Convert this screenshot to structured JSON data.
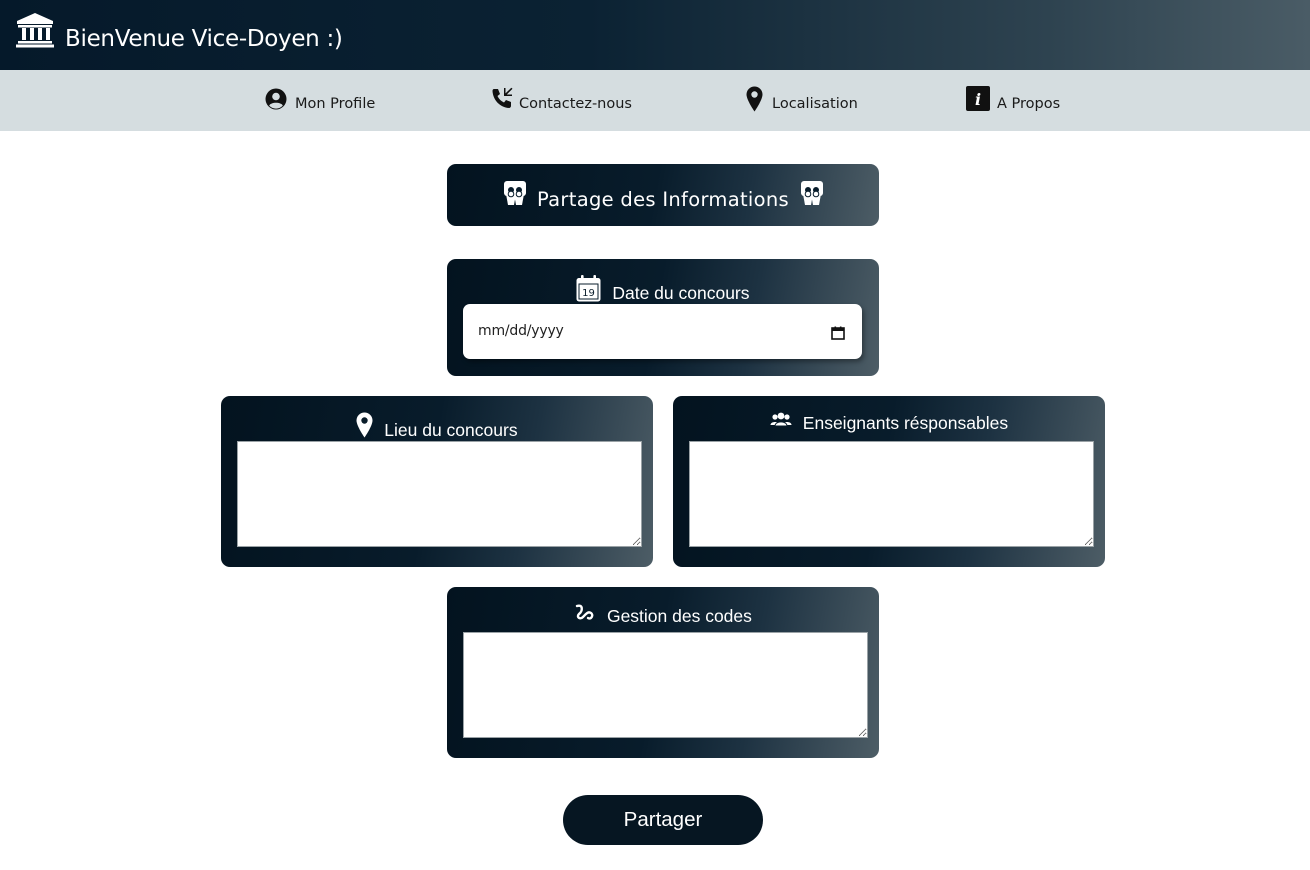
{
  "header": {
    "title": "BienVenue Vice-Doyen :)",
    "logo_icon": "university-building-icon"
  },
  "nav": {
    "items": [
      {
        "label": "Mon Profile",
        "icon": "user-circle-icon"
      },
      {
        "label": "Contactez-nous",
        "icon": "phone-icon"
      },
      {
        "label": "Localisation",
        "icon": "map-marker-icon"
      },
      {
        "label": "A Propos",
        "icon": "info-icon"
      }
    ]
  },
  "main": {
    "section_title": "Partage des Informations",
    "section_icon": "share-people-icon",
    "date": {
      "label": "Date du concours",
      "icon": "calendar-icon",
      "calendar_day": "19",
      "placeholder": "mm/dd/yyyy"
    },
    "lieu": {
      "label": "Lieu du concours",
      "icon": "map-marker-icon",
      "value": ""
    },
    "enseignants": {
      "label": "Enseignants résponsables",
      "icon": "users-icon",
      "value": ""
    },
    "codes": {
      "label": "Gestion des codes",
      "icon": "squiggle-icon",
      "value": ""
    },
    "submit_label": "Partager"
  },
  "colors": {
    "header_dark": "#05192a",
    "header_light": "#4a5c66",
    "nav_bg": "#d5dde0",
    "panel_dark": "#03131f",
    "button_bg": "#061622"
  }
}
